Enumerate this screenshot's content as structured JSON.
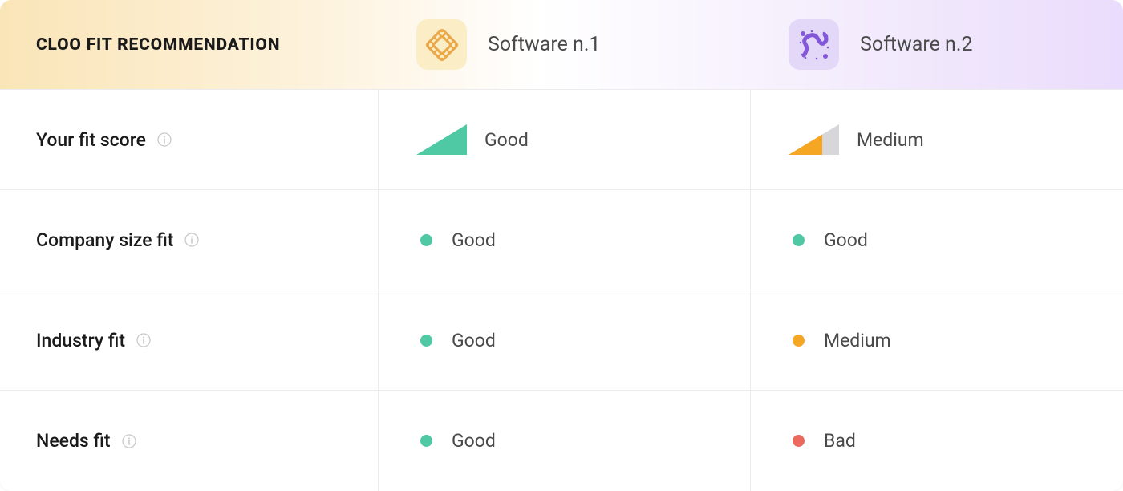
{
  "header": {
    "title": "CLOO FIT RECOMMENDATION",
    "software1": "Software n.1",
    "software2": "Software n.2"
  },
  "rows": {
    "fit_score": {
      "label": "Your fit score",
      "software1": {
        "value": "Good",
        "level": "good"
      },
      "software2": {
        "value": "Medium",
        "level": "medium"
      }
    },
    "company_size": {
      "label": "Company size fit",
      "software1": {
        "value": "Good",
        "level": "good"
      },
      "software2": {
        "value": "Good",
        "level": "good"
      }
    },
    "industry": {
      "label": "Industry fit",
      "software1": {
        "value": "Good",
        "level": "good"
      },
      "software2": {
        "value": "Medium",
        "level": "medium"
      }
    },
    "needs": {
      "label": "Needs fit",
      "software1": {
        "value": "Good",
        "level": "good"
      },
      "software2": {
        "value": "Bad",
        "level": "bad"
      }
    }
  },
  "colors": {
    "good": "#4EC9A3",
    "medium": "#F5A623",
    "bad": "#EA6A5E"
  }
}
